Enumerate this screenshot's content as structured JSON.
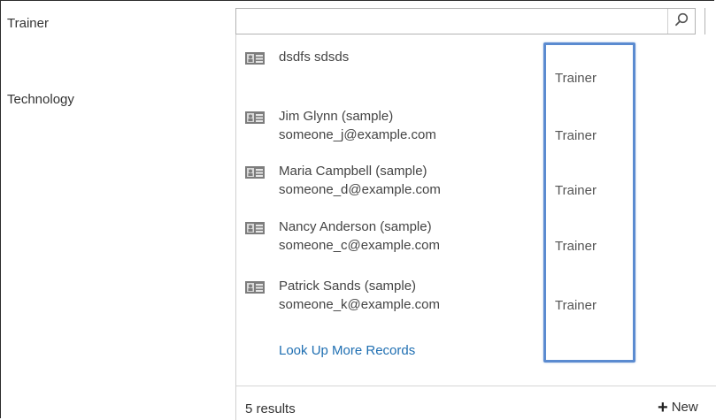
{
  "form": {
    "trainer_label": "Trainer",
    "technology_label": "Technology"
  },
  "lookup": {
    "input_value": "",
    "search_icon": "search-icon"
  },
  "results": [
    {
      "name": "dsdfs sdsds",
      "email": "",
      "role": "Trainer"
    },
    {
      "name": "Jim Glynn (sample)",
      "email": "someone_j@example.com",
      "role": "Trainer"
    },
    {
      "name": "Maria Campbell (sample)",
      "email": "someone_d@example.com",
      "role": "Trainer"
    },
    {
      "name": "Nancy Anderson (sample)",
      "email": "someone_c@example.com",
      "role": "Trainer"
    },
    {
      "name": "Patrick Sands (sample)",
      "email": "someone_k@example.com",
      "role": "Trainer"
    }
  ],
  "lookup_more_label": "Look Up More Records",
  "footer": {
    "count_label": "5 results",
    "new_label": "New"
  },
  "colors": {
    "highlight": "#5b8bd0",
    "link": "#1f6fb2"
  }
}
